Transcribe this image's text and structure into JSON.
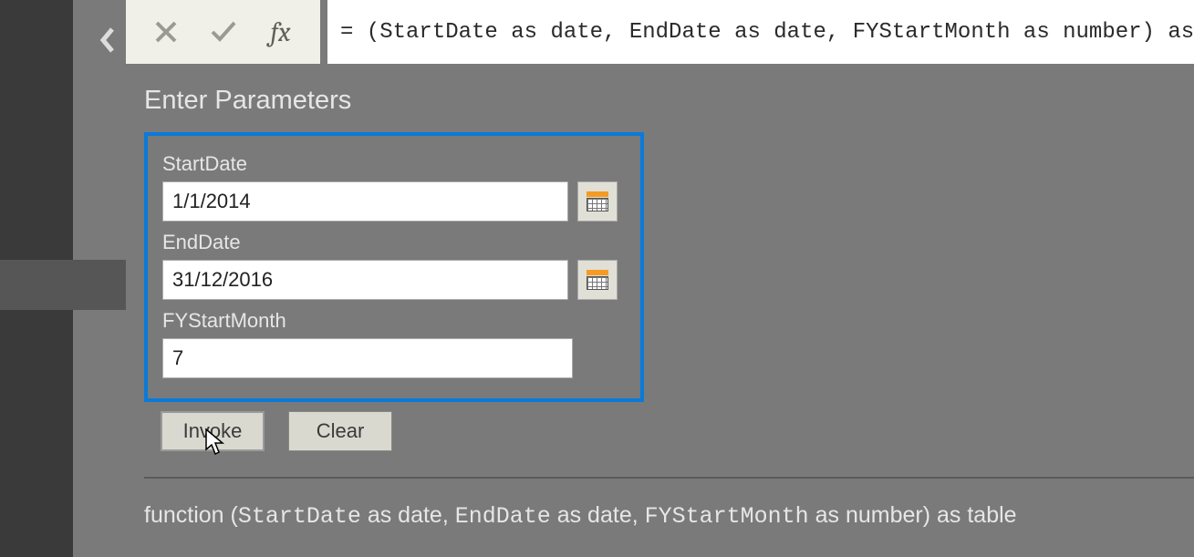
{
  "formula_bar": {
    "text": "= (StartDate as date, EndDate as date, FYStartMonth as number) as table"
  },
  "heading": "Enter Parameters",
  "params": {
    "start_date": {
      "label": "StartDate",
      "value": "1/1/2014"
    },
    "end_date": {
      "label": "EndDate",
      "value": "31/12/2016"
    },
    "fy_start_month": {
      "label": "FYStartMonth",
      "value": "7"
    }
  },
  "buttons": {
    "invoke": "Invoke",
    "clear": "Clear"
  },
  "signature": {
    "prefix": "function (",
    "p1": "StartDate",
    "as1": " as date, ",
    "p2": "EndDate",
    "as2": " as date, ",
    "p3": "FYStartMonth",
    "as3": " as number) as table"
  },
  "fx_label": "fx"
}
